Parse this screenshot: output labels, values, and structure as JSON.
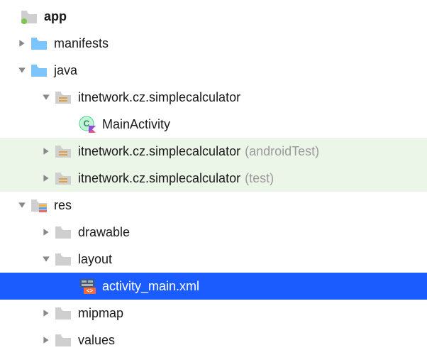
{
  "colors": {
    "folder_blue": "#7cc5fc",
    "folder_gray": "#cfcfcf",
    "package_line": "#e0a03c",
    "selection": "#1a5cff",
    "test_bg": "#ecf6e8",
    "kotlin_teal": "#3ddc84",
    "kotlin_accent": "#e44e8a",
    "xml_orange": "#f26b3a",
    "xml_dark": "#4a5a6a"
  },
  "root": {
    "label": "app"
  },
  "manifests": {
    "label": "manifests"
  },
  "java": {
    "label": "java"
  },
  "pkg_main": {
    "label": "itnetwork.cz.simplecalculator"
  },
  "main_activity": {
    "label": "MainActivity"
  },
  "pkg_android_test": {
    "label": "itnetwork.cz.simplecalculator",
    "suffix": "(androidTest)"
  },
  "pkg_test": {
    "label": "itnetwork.cz.simplecalculator",
    "suffix": "(test)"
  },
  "res": {
    "label": "res"
  },
  "drawable": {
    "label": "drawable"
  },
  "layout": {
    "label": "layout"
  },
  "activity_main": {
    "label": "activity_main.xml"
  },
  "mipmap": {
    "label": "mipmap"
  },
  "values": {
    "label": "values"
  }
}
